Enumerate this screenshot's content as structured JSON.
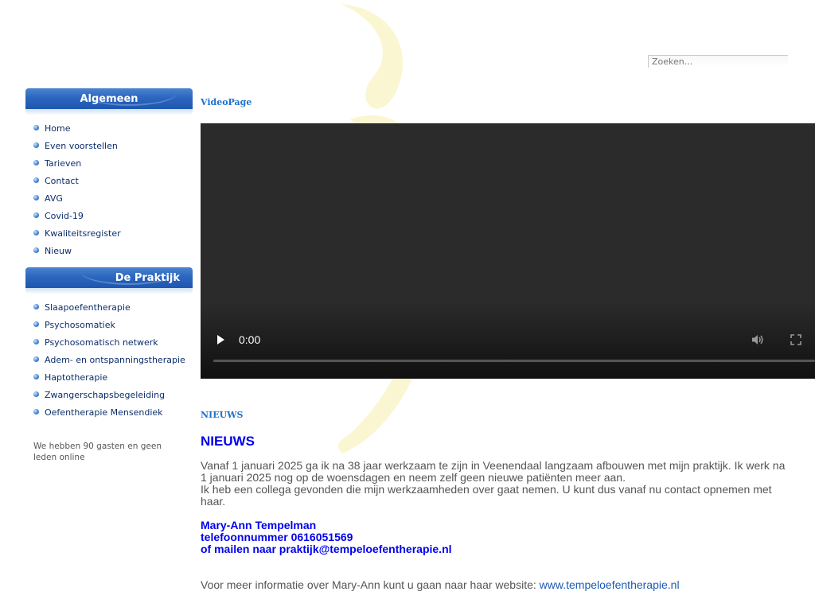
{
  "search": {
    "placeholder": "Zoeken..."
  },
  "colors": {
    "accent": "#1e56b0",
    "link": "#0b2d6b",
    "headline": "#0000ee",
    "title": "#1e73cc",
    "decor": "#fbf6c8"
  },
  "sidebar": {
    "module1": {
      "title": "Algemeen",
      "items": [
        "Home",
        "Even voorstellen",
        "Tarieven",
        "Contact",
        "AVG",
        "Covid-19",
        "Kwaliteitsregister",
        "Nieuw"
      ]
    },
    "module2": {
      "title": "De Praktijk",
      "items": [
        "Slaapoefentherapie",
        "Psychosomatiek",
        "Psychosomatisch netwerk",
        "Adem- en ontspanningstherapie",
        "Haptotherapie",
        "Zwangerschapsbegeleiding",
        "Oefentherapie Mensendiek"
      ]
    },
    "online_text": "We hebben 90 gasten en geen leden online"
  },
  "content": {
    "video_title": "VideoPage",
    "video": {
      "time": "0:00",
      "progress": 0
    },
    "news_label": "NIEUWS",
    "news_heading": "NIEUWS",
    "paragraph1": "Vanaf 1 januari 2025 ga ik na 38 jaar werkzaam te zijn in Veenendaal langzaam afbouwen met mijn praktijk. Ik werk na 1 januari 2025 nog op de woensdagen en neem zelf geen nieuwe patiënten meer aan.",
    "paragraph2": "Ik heb een collega gevonden die mijn werkzaamheden over gaat nemen. U kunt dus vanaf nu contact opnemen met haar.",
    "contact_name": "Mary-Ann Tempelman",
    "contact_phone": "telefoonnummer 0616051569",
    "contact_mail": "of mailen naar praktijk@tempeloefentherapie.nl",
    "more_info": "Voor meer informatie over Mary-Ann kunt u gaan naar haar website: ",
    "more_link": "www.tempeloefentherapie.nl"
  },
  "icons": [
    "play-icon",
    "volume-icon",
    "fullscreen-icon",
    "menu-bullet-icon"
  ]
}
